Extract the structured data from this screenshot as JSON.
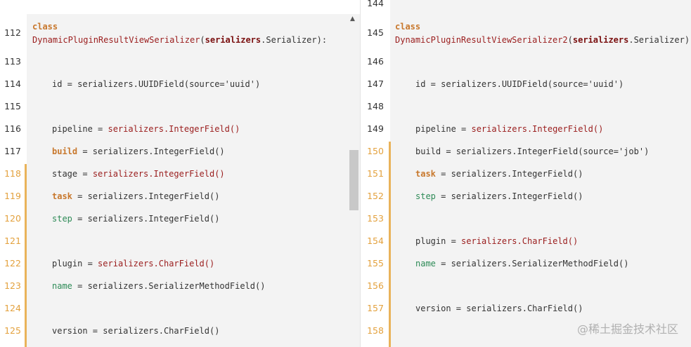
{
  "left": {
    "lines": [
      {
        "n": "112",
        "changed": false
      },
      {
        "n": "113",
        "changed": false
      },
      {
        "n": "114",
        "changed": false
      },
      {
        "n": "115",
        "changed": false
      },
      {
        "n": "116",
        "changed": false
      },
      {
        "n": "117",
        "changed": false
      },
      {
        "n": "118",
        "changed": true
      },
      {
        "n": "119",
        "changed": true
      },
      {
        "n": "120",
        "changed": true
      },
      {
        "n": "121",
        "changed": true
      },
      {
        "n": "122",
        "changed": true
      },
      {
        "n": "123",
        "changed": true
      },
      {
        "n": "124",
        "changed": true
      },
      {
        "n": "125",
        "changed": true
      }
    ],
    "class_kw": "class",
    "class_name": "DynamicPluginResultViewSerializer",
    "class_paren": "(",
    "class_base_mod": "serializers",
    "class_base_rest": ".Serializer):",
    "id_line": "id = serializers.UUIDField(source='uuid')",
    "pipeline_name": "pipeline",
    "pipeline_eq": " = ",
    "pipeline_val": "serializers.IntegerField()",
    "build_name": "build",
    "build_rest": " = serializers.IntegerField()",
    "stage_name": "stage",
    "stage_eq": " = ",
    "stage_val": "serializers.IntegerField()",
    "task_name": "task",
    "task_rest": " = serializers.IntegerField()",
    "step_name": "step",
    "step_rest": " = serializers.IntegerField()",
    "plugin_name": "plugin",
    "plugin_eq": " = ",
    "plugin_val": "serializers.CharField()",
    "name_name": "name",
    "name_rest": " = serializers.SerializerMethodField()",
    "version_line": "version = serializers.CharField()",
    "scroll_up_glyph": "▲"
  },
  "right": {
    "lines": [
      {
        "n": "144",
        "changed": false
      },
      {
        "n": "145",
        "changed": false
      },
      {
        "n": "146",
        "changed": false
      },
      {
        "n": "147",
        "changed": false
      },
      {
        "n": "148",
        "changed": false
      },
      {
        "n": "149",
        "changed": false
      },
      {
        "n": "150",
        "changed": true
      },
      {
        "n": "151",
        "changed": true
      },
      {
        "n": "152",
        "changed": true
      },
      {
        "n": "153",
        "changed": true
      },
      {
        "n": "154",
        "changed": true
      },
      {
        "n": "155",
        "changed": true
      },
      {
        "n": "156",
        "changed": true
      },
      {
        "n": "157",
        "changed": true
      },
      {
        "n": "158",
        "changed": true
      }
    ],
    "class_kw": "class",
    "class_name": "DynamicPluginResultViewSerializer2",
    "class_paren": "(",
    "class_base_mod": "serializers",
    "class_base_rest": ".Serializer):",
    "id_line": "id = serializers.UUIDField(source='uuid')",
    "pipeline_name": "pipeline",
    "pipeline_eq": " = ",
    "pipeline_val": "serializers.IntegerField()",
    "build_line": "build = serializers.IntegerField(source='job')",
    "task_name": "task",
    "task_rest": " = serializers.IntegerField()",
    "step_name": "step",
    "step_rest": " = serializers.IntegerField()",
    "plugin_name": "plugin",
    "plugin_eq": " = ",
    "plugin_val": "serializers.CharField()",
    "name_name": "name",
    "name_rest": " = serializers.SerializerMethodField()",
    "version_line": "version = serializers.CharField()"
  },
  "watermark": "@稀土掘金技术社区",
  "colors": {
    "changed_bar": "#e9b35a",
    "keyword": "#c8782d",
    "class_name": "#9a1c1c",
    "attr": "#2e8b57"
  }
}
